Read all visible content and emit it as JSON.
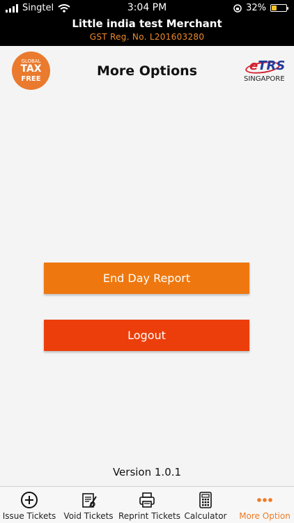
{
  "status_bar": {
    "carrier": "Singtel",
    "time": "3:04 PM",
    "battery": "32%"
  },
  "merchant": {
    "name": "Little india test Merchant",
    "gst": "GST Reg. No. L201603280"
  },
  "header": {
    "title": "More Options",
    "left_logo": {
      "line1": "GLOBAL",
      "line2": "TAX",
      "line3": "FREE"
    },
    "right_logo": {
      "mark": "eTRS",
      "subtitle": "SINGAPORE"
    }
  },
  "actions": {
    "end_day_report": "End Day Report",
    "logout": "Logout"
  },
  "version": "Version 1.0.1",
  "tabs": [
    {
      "label": "Issue Tickets",
      "icon": "plus-circle-icon"
    },
    {
      "label": "Void Tickets",
      "icon": "void-document-icon"
    },
    {
      "label": "Reprint Tickets",
      "icon": "printer-icon"
    },
    {
      "label": "Calculator",
      "icon": "calculator-icon"
    },
    {
      "label": "More Option",
      "icon": "more-dots-icon",
      "active": true
    }
  ],
  "colors": {
    "accent": "#ee780f",
    "logout": "#ec3e0a",
    "gst_text": "#f08a2a",
    "active_tab": "#ef7a22"
  }
}
